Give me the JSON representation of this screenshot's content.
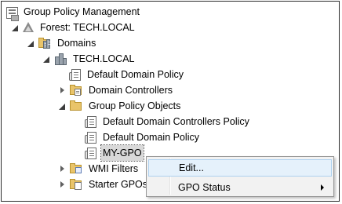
{
  "tree": {
    "root": {
      "label": "Group Policy Management",
      "icon": "gpmc-console-icon"
    },
    "forest": {
      "label": "Forest: TECH.LOCAL",
      "icon": "forest-icon",
      "expanded": true
    },
    "domains": {
      "label": "Domains",
      "icon": "domains-folder-icon",
      "expanded": true
    },
    "domain": {
      "label": "TECH.LOCAL",
      "icon": "domain-icon",
      "expanded": true
    },
    "domain_children": [
      {
        "label": "Default Domain Policy",
        "icon": "gpo-link-icon"
      },
      {
        "label": "Domain Controllers",
        "icon": "ou-folder-icon",
        "expanded": false
      },
      {
        "label": "Group Policy Objects",
        "icon": "folder-icon",
        "expanded": true
      }
    ],
    "gpo_objects": [
      {
        "label": "Default Domain Controllers Policy",
        "icon": "gpo-icon"
      },
      {
        "label": "Default Domain Policy",
        "icon": "gpo-icon"
      },
      {
        "label": "MY-GPO",
        "icon": "gpo-icon",
        "selected": true
      }
    ],
    "more": [
      {
        "label": "WMI Filters",
        "icon": "wmi-folder-icon",
        "expanded": false
      },
      {
        "label": "Starter GPOs",
        "icon": "starter-folder-icon",
        "expanded": false
      }
    ]
  },
  "context_menu": {
    "items": [
      {
        "label": "Edit...",
        "highlighted": true
      },
      {
        "label": "GPO Status",
        "has_submenu": true
      }
    ]
  }
}
